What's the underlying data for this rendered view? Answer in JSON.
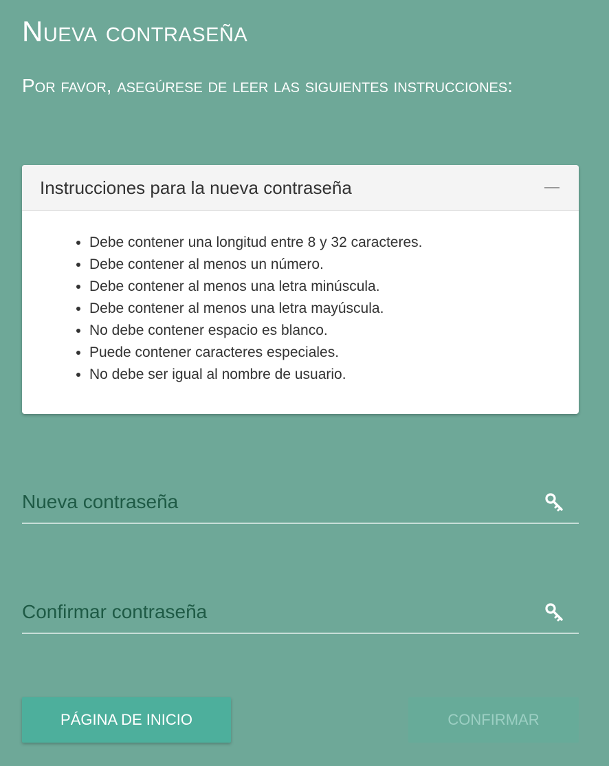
{
  "header": {
    "title": "Nueva contraseña",
    "subtitle": "Por favor, asegúrese de leer las siguientes instrucciones:"
  },
  "panel": {
    "title": "Instrucciones para la nueva contraseña",
    "rules": [
      "Debe contener una longitud entre 8 y 32 caracteres.",
      "Debe contener al menos un número.",
      "Debe contener al menos una letra minúscula.",
      "Debe contener al menos una letra mayúscula.",
      "No debe contener espacio es blanco.",
      "Puede contener caracteres especiales.",
      "No debe ser igual al nombre de usuario."
    ],
    "collapse_icon": "minus-icon"
  },
  "form": {
    "new_password": {
      "placeholder": "Nueva contraseña",
      "value": "",
      "icon": "key-icon"
    },
    "confirm_password": {
      "placeholder": "Confirmar contraseña",
      "value": "",
      "icon": "key-icon"
    }
  },
  "buttons": {
    "home_label": "Página de inicio",
    "confirm_label": "Confirmar"
  },
  "colors": {
    "background": "#6ea898",
    "primary_button": "#4daf9c",
    "disabled_button_text": "#9ccfc3",
    "field_text": "#1e5a45"
  }
}
